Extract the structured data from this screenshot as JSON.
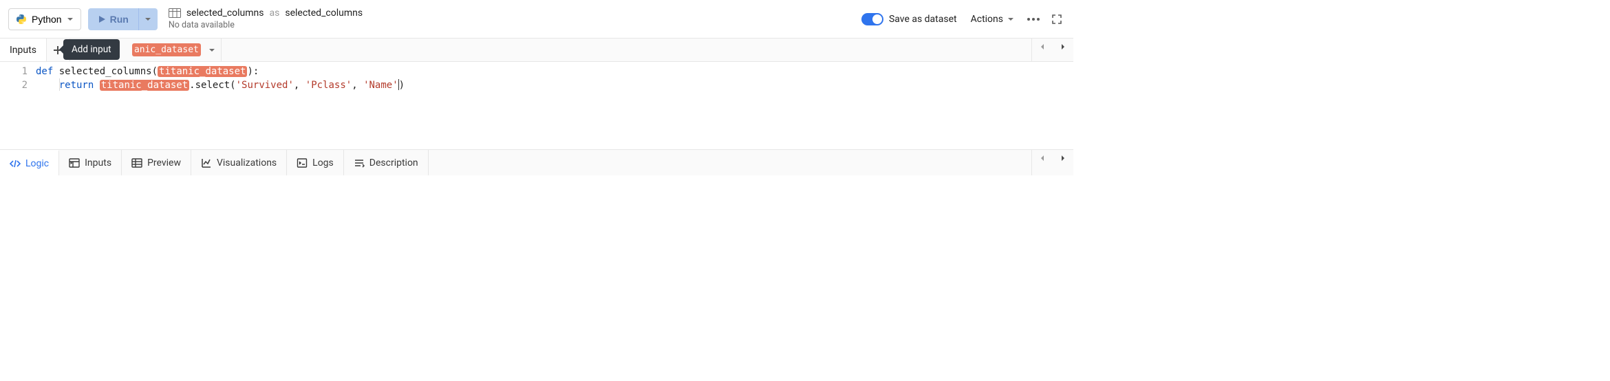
{
  "toolbar": {
    "language": "Python",
    "run_label": "Run",
    "title_main": "selected_columns",
    "title_as": "as",
    "title_alias": "selected_columns",
    "subtitle": "No data available",
    "save_toggle_label": "Save as dataset",
    "actions_label": "Actions"
  },
  "inputs": {
    "label": "Inputs",
    "tooltip": "Add input",
    "chip_visible": "anic_dataset"
  },
  "code": {
    "line_numbers": [
      "1",
      "2"
    ],
    "l1": {
      "kw_def": "def",
      "fn": "selected_columns",
      "param": "titanic_dataset"
    },
    "l2": {
      "kw_return": "return",
      "obj": "titanic_dataset",
      "method": ".select(",
      "s1": "'Survived'",
      "c1": ", ",
      "s2": "'Pclass'",
      "c2": ", ",
      "s3": "'Name'",
      "close": ")"
    }
  },
  "tabs": {
    "logic": "Logic",
    "inputs": "Inputs",
    "preview": "Preview",
    "visualizations": "Visualizations",
    "logs": "Logs",
    "description": "Description"
  }
}
